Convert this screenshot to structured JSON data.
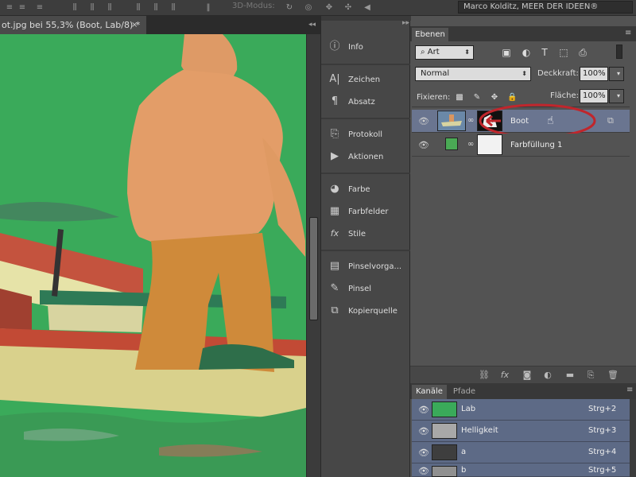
{
  "options_bar": {
    "mode_label": "3D-Modus:",
    "workspace": "Marco Kolditz, MEER DER IDEEN®"
  },
  "document": {
    "tab_title": "ot.jpg bei 55,3% (Boot, Lab/8) *",
    "close": "×"
  },
  "dock": {
    "items": [
      {
        "label": "Info",
        "icon": "info-icon"
      },
      {
        "label": "Zeichen",
        "icon": "character-icon"
      },
      {
        "label": "Absatz",
        "icon": "paragraph-icon"
      },
      {
        "label": "Protokoll",
        "icon": "history-icon"
      },
      {
        "label": "Aktionen",
        "icon": "actions-play-icon"
      },
      {
        "label": "Farbe",
        "icon": "color-palette-icon"
      },
      {
        "label": "Farbfelder",
        "icon": "swatches-grid-icon"
      },
      {
        "label": "Stile",
        "icon": "fx-styles-icon"
      },
      {
        "label": "Pinselvorga...",
        "icon": "brush-presets-icon"
      },
      {
        "label": "Pinsel",
        "icon": "brush-icon"
      },
      {
        "label": "Kopierquelle",
        "icon": "clone-source-icon"
      }
    ]
  },
  "layers_panel": {
    "tab": "Ebenen",
    "filter_kind": "Art",
    "blend_mode": "Normal",
    "opacity_label": "Deckkraft:",
    "opacity_value": "100%",
    "lock_label": "Fixieren:",
    "fill_label": "Fläche:",
    "fill_value": "100%",
    "layers": [
      {
        "name": "Boot",
        "selected": true
      },
      {
        "name": "Farbfüllung 1",
        "selected": false
      }
    ],
    "colors": {
      "fill_swatch": "#4aaa55",
      "selection_highlight": "#c0262c"
    }
  },
  "channels_panel": {
    "tabs": [
      "Kanäle",
      "Pfade"
    ],
    "channels": [
      {
        "name": "Lab",
        "shortcut": "Strg+2"
      },
      {
        "name": "Helligkeit",
        "shortcut": "Strg+3"
      },
      {
        "name": "a",
        "shortcut": "Strg+4"
      },
      {
        "name": "b",
        "shortcut": "Strg+5"
      }
    ]
  }
}
